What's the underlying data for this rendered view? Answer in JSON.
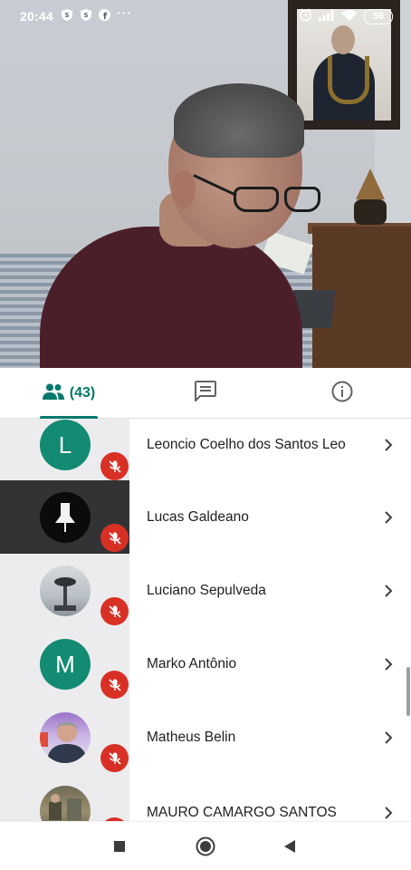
{
  "status_bar": {
    "time": "20:44",
    "more_dots": "···",
    "battery": "56",
    "icons": [
      "shield-icon",
      "shield-icon",
      "facebook-icon",
      "alarm-icon",
      "signal-icon",
      "wifi-icon",
      "battery-icon"
    ]
  },
  "tabs": {
    "people": {
      "count": "(43)",
      "icon": "people-icon",
      "selected": true
    },
    "chat": {
      "icon": "chat-icon"
    },
    "info": {
      "icon": "info-icon"
    }
  },
  "participants": [
    {
      "name": "Leoncio Coelho dos Santos Leo",
      "avatar": "L",
      "avatar_type": "letter",
      "muted": true
    },
    {
      "name": "Lucas Galdeano",
      "avatar": "",
      "avatar_type": "image",
      "muted": true
    },
    {
      "name": "Luciano Sepulveda",
      "avatar": "",
      "avatar_type": "image",
      "muted": true
    },
    {
      "name": "Marko Antônio",
      "avatar": "M",
      "avatar_type": "letter",
      "muted": true
    },
    {
      "name": "Matheus Belin",
      "avatar": "",
      "avatar_type": "image",
      "muted": true
    },
    {
      "name": "MAURO CAMARGO SANTOS",
      "avatar": "",
      "avatar_type": "image",
      "muted": true
    }
  ],
  "colors": {
    "accent": "#00796b",
    "avatar_green": "#138a72",
    "muted_red": "#d93025"
  },
  "nav": {
    "buttons": [
      "recents-square-icon",
      "home-circle-icon",
      "back-triangle-icon"
    ]
  }
}
